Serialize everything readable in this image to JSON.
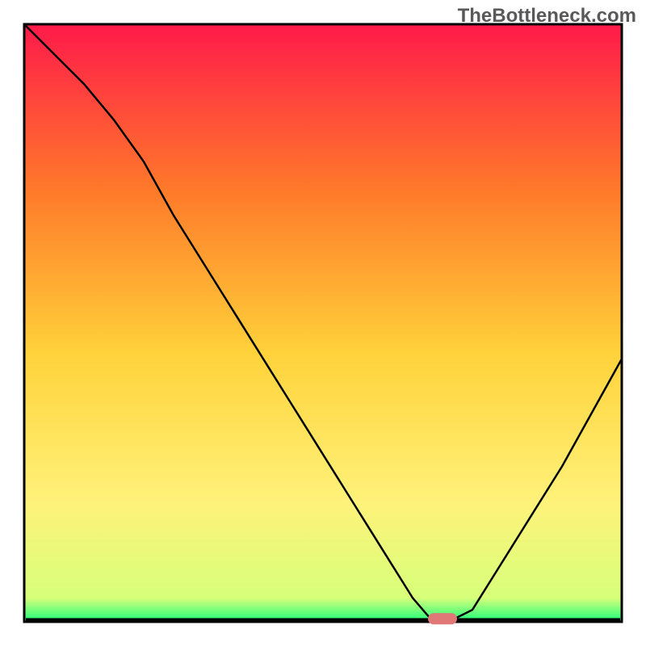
{
  "watermark": "TheBottleneck.com",
  "chart_data": {
    "type": "line",
    "title": "",
    "xlabel": "",
    "ylabel": "",
    "xlim": [
      0,
      100
    ],
    "ylim": [
      0,
      100
    ],
    "x": [
      0,
      5,
      10,
      15,
      20,
      25,
      30,
      35,
      40,
      45,
      50,
      55,
      60,
      65,
      68,
      72,
      75,
      80,
      85,
      90,
      95,
      100
    ],
    "y": [
      100,
      95,
      90,
      84,
      77,
      68,
      60,
      52,
      44,
      36,
      28,
      20,
      12,
      4,
      0.5,
      0.5,
      2,
      10,
      18,
      26,
      35,
      44
    ],
    "gradient_background": {
      "top": "#ff1a4a",
      "mid_upper": "#ff7a2a",
      "mid": "#ffd23a",
      "mid_lower": "#fff27a",
      "bottom": "#1aff7a"
    },
    "line_color": "#000000",
    "baseline_color": "#000000",
    "marker": {
      "x": 70,
      "y": 0.5,
      "color": "#e07878"
    }
  }
}
